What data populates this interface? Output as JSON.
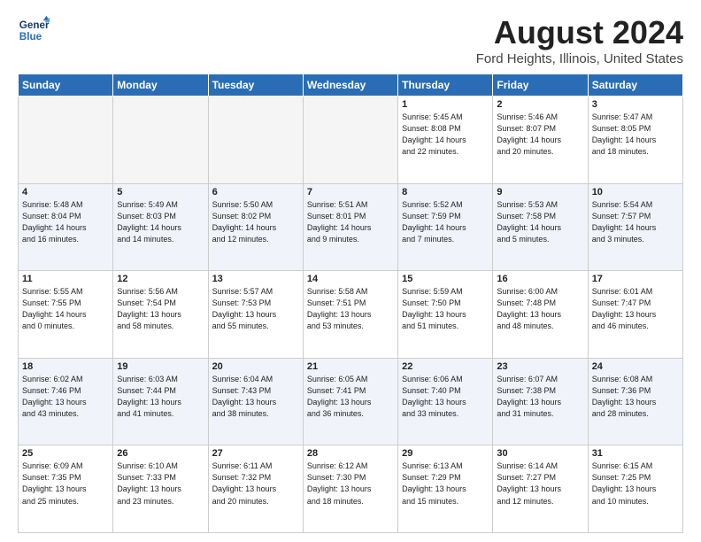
{
  "header": {
    "logo_line1": "General",
    "logo_line2": "Blue",
    "main_title": "August 2024",
    "subtitle": "Ford Heights, Illinois, United States"
  },
  "days_of_week": [
    "Sunday",
    "Monday",
    "Tuesday",
    "Wednesday",
    "Thursday",
    "Friday",
    "Saturday"
  ],
  "weeks": [
    [
      {
        "day": "",
        "info": ""
      },
      {
        "day": "",
        "info": ""
      },
      {
        "day": "",
        "info": ""
      },
      {
        "day": "",
        "info": ""
      },
      {
        "day": "1",
        "info": "Sunrise: 5:45 AM\nSunset: 8:08 PM\nDaylight: 14 hours\nand 22 minutes."
      },
      {
        "day": "2",
        "info": "Sunrise: 5:46 AM\nSunset: 8:07 PM\nDaylight: 14 hours\nand 20 minutes."
      },
      {
        "day": "3",
        "info": "Sunrise: 5:47 AM\nSunset: 8:05 PM\nDaylight: 14 hours\nand 18 minutes."
      }
    ],
    [
      {
        "day": "4",
        "info": "Sunrise: 5:48 AM\nSunset: 8:04 PM\nDaylight: 14 hours\nand 16 minutes."
      },
      {
        "day": "5",
        "info": "Sunrise: 5:49 AM\nSunset: 8:03 PM\nDaylight: 14 hours\nand 14 minutes."
      },
      {
        "day": "6",
        "info": "Sunrise: 5:50 AM\nSunset: 8:02 PM\nDaylight: 14 hours\nand 12 minutes."
      },
      {
        "day": "7",
        "info": "Sunrise: 5:51 AM\nSunset: 8:01 PM\nDaylight: 14 hours\nand 9 minutes."
      },
      {
        "day": "8",
        "info": "Sunrise: 5:52 AM\nSunset: 7:59 PM\nDaylight: 14 hours\nand 7 minutes."
      },
      {
        "day": "9",
        "info": "Sunrise: 5:53 AM\nSunset: 7:58 PM\nDaylight: 14 hours\nand 5 minutes."
      },
      {
        "day": "10",
        "info": "Sunrise: 5:54 AM\nSunset: 7:57 PM\nDaylight: 14 hours\nand 3 minutes."
      }
    ],
    [
      {
        "day": "11",
        "info": "Sunrise: 5:55 AM\nSunset: 7:55 PM\nDaylight: 14 hours\nand 0 minutes."
      },
      {
        "day": "12",
        "info": "Sunrise: 5:56 AM\nSunset: 7:54 PM\nDaylight: 13 hours\nand 58 minutes."
      },
      {
        "day": "13",
        "info": "Sunrise: 5:57 AM\nSunset: 7:53 PM\nDaylight: 13 hours\nand 55 minutes."
      },
      {
        "day": "14",
        "info": "Sunrise: 5:58 AM\nSunset: 7:51 PM\nDaylight: 13 hours\nand 53 minutes."
      },
      {
        "day": "15",
        "info": "Sunrise: 5:59 AM\nSunset: 7:50 PM\nDaylight: 13 hours\nand 51 minutes."
      },
      {
        "day": "16",
        "info": "Sunrise: 6:00 AM\nSunset: 7:48 PM\nDaylight: 13 hours\nand 48 minutes."
      },
      {
        "day": "17",
        "info": "Sunrise: 6:01 AM\nSunset: 7:47 PM\nDaylight: 13 hours\nand 46 minutes."
      }
    ],
    [
      {
        "day": "18",
        "info": "Sunrise: 6:02 AM\nSunset: 7:46 PM\nDaylight: 13 hours\nand 43 minutes."
      },
      {
        "day": "19",
        "info": "Sunrise: 6:03 AM\nSunset: 7:44 PM\nDaylight: 13 hours\nand 41 minutes."
      },
      {
        "day": "20",
        "info": "Sunrise: 6:04 AM\nSunset: 7:43 PM\nDaylight: 13 hours\nand 38 minutes."
      },
      {
        "day": "21",
        "info": "Sunrise: 6:05 AM\nSunset: 7:41 PM\nDaylight: 13 hours\nand 36 minutes."
      },
      {
        "day": "22",
        "info": "Sunrise: 6:06 AM\nSunset: 7:40 PM\nDaylight: 13 hours\nand 33 minutes."
      },
      {
        "day": "23",
        "info": "Sunrise: 6:07 AM\nSunset: 7:38 PM\nDaylight: 13 hours\nand 31 minutes."
      },
      {
        "day": "24",
        "info": "Sunrise: 6:08 AM\nSunset: 7:36 PM\nDaylight: 13 hours\nand 28 minutes."
      }
    ],
    [
      {
        "day": "25",
        "info": "Sunrise: 6:09 AM\nSunset: 7:35 PM\nDaylight: 13 hours\nand 25 minutes."
      },
      {
        "day": "26",
        "info": "Sunrise: 6:10 AM\nSunset: 7:33 PM\nDaylight: 13 hours\nand 23 minutes."
      },
      {
        "day": "27",
        "info": "Sunrise: 6:11 AM\nSunset: 7:32 PM\nDaylight: 13 hours\nand 20 minutes."
      },
      {
        "day": "28",
        "info": "Sunrise: 6:12 AM\nSunset: 7:30 PM\nDaylight: 13 hours\nand 18 minutes."
      },
      {
        "day": "29",
        "info": "Sunrise: 6:13 AM\nSunset: 7:29 PM\nDaylight: 13 hours\nand 15 minutes."
      },
      {
        "day": "30",
        "info": "Sunrise: 6:14 AM\nSunset: 7:27 PM\nDaylight: 13 hours\nand 12 minutes."
      },
      {
        "day": "31",
        "info": "Sunrise: 6:15 AM\nSunset: 7:25 PM\nDaylight: 13 hours\nand 10 minutes."
      }
    ]
  ]
}
